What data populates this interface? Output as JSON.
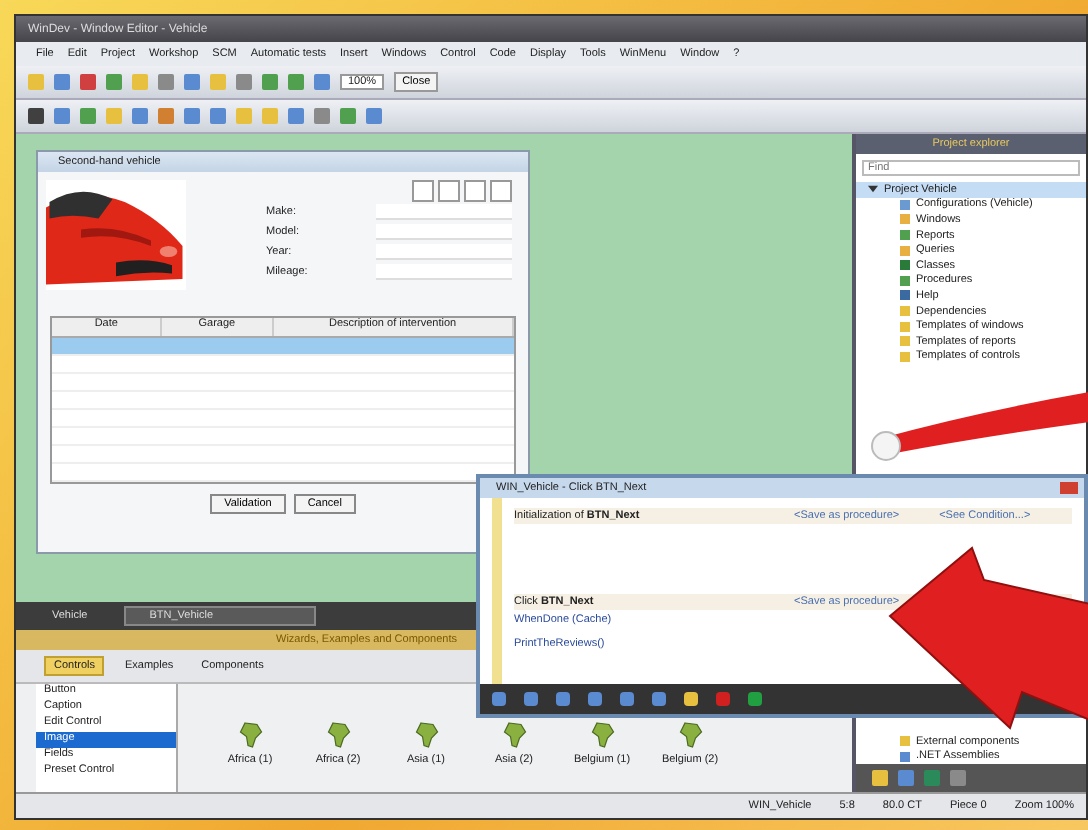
{
  "window": {
    "title": "WinDev - Window Editor - Vehicle"
  },
  "menu": [
    "File",
    "Edit",
    "Project",
    "Workshop",
    "SCM",
    "Automatic tests",
    "Insert",
    "Windows",
    "Control",
    "Code",
    "Display",
    "Tools",
    "WinMenu",
    "Window",
    "?"
  ],
  "toolbar": {
    "zoom": "100%",
    "close": "Close"
  },
  "form_window": {
    "title": "Second-hand vehicle",
    "fields": [
      {
        "label": "Make:"
      },
      {
        "label": "Model:"
      },
      {
        "label": "Year:"
      },
      {
        "label": "Mileage:"
      }
    ],
    "table": {
      "columns": [
        "Date",
        "Garage",
        "Description of intervention"
      ],
      "rows": [
        {
          "selected": true
        },
        {
          "selected": false
        },
        {
          "selected": false
        },
        {
          "selected": false
        },
        {
          "selected": false
        },
        {
          "selected": false
        },
        {
          "selected": false
        },
        {
          "selected": false
        }
      ]
    },
    "buttons": [
      "Validation",
      "Cancel"
    ]
  },
  "editor_tabs": [
    {
      "label": "Vehicle",
      "selected": false
    },
    {
      "label": "BTN_Vehicle",
      "selected": true
    }
  ],
  "catalog": {
    "title": "Wizards, Examples and Components",
    "tabs": [
      {
        "label": "Controls",
        "selected": true
      },
      {
        "label": "Examples",
        "selected": false
      },
      {
        "label": "Components",
        "selected": false
      }
    ],
    "categories": [
      {
        "label": "Button",
        "selected": false
      },
      {
        "label": "Caption",
        "selected": false
      },
      {
        "label": "Edit Control",
        "selected": false
      },
      {
        "label": "Image",
        "selected": true
      },
      {
        "label": "Fields",
        "selected": false
      },
      {
        "label": "Preset Control",
        "selected": false
      }
    ],
    "items": [
      {
        "label": "Africa (1)"
      },
      {
        "label": "Africa (2)"
      },
      {
        "label": "Asia (1)"
      },
      {
        "label": "Asia (2)"
      },
      {
        "label": "Belgium (1)"
      },
      {
        "label": "Belgium (2)"
      }
    ]
  },
  "project_explorer": {
    "title": "Project explorer",
    "search": {
      "placeholder": "Find"
    },
    "root": {
      "label": "Project Vehicle",
      "selected": true,
      "expanded": true
    },
    "children": [
      {
        "label": "Configurations (Vehicle)"
      },
      {
        "label": "Windows"
      },
      {
        "label": "Reports"
      },
      {
        "label": "Queries"
      },
      {
        "label": "Classes"
      },
      {
        "label": "Procedures"
      },
      {
        "label": "Help"
      },
      {
        "label": "Dependencies"
      },
      {
        "label": "Templates of windows"
      },
      {
        "label": "Templates of reports"
      },
      {
        "label": "Templates of controls"
      },
      {
        "label": "External components"
      },
      {
        "label": ".NET Assemblies"
      }
    ]
  },
  "code_window": {
    "title": "WIN_Vehicle - Click BTN_Next",
    "sections": [
      {
        "title": "Initialization of **BTN_Next**",
        "note": "<Save as procedure>",
        "extra": "<See Condition...>"
      },
      {
        "title": "Click **BTN_Next**",
        "note": "<Save as procedure>",
        "lines": [
          "WhenDone (Cache)",
          "PrintTheReviews()"
        ]
      }
    ]
  },
  "status_bar": [
    "WIN_Vehicle",
    "5:8",
    "80.0 CT",
    "Piece 0",
    "Zoom 100%"
  ]
}
